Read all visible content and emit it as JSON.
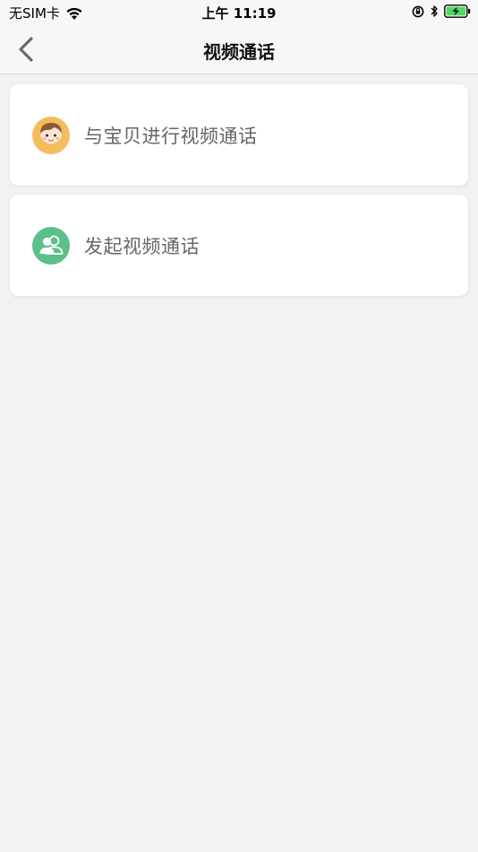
{
  "status_bar": {
    "carrier": "无SIM卡",
    "time": "上午 11:19",
    "icons": [
      "wifi-icon",
      "orientation-lock-icon",
      "bluetooth-icon",
      "battery-charging-icon"
    ]
  },
  "nav": {
    "title": "视频通话",
    "back_icon": "chevron-left-icon"
  },
  "options": [
    {
      "label": "与宝贝进行视频通话",
      "icon": "child-face-icon",
      "icon_color": "#f3bd5b"
    },
    {
      "label": "发起视频通话",
      "icon": "group-people-icon",
      "icon_color": "#5bc08a"
    }
  ],
  "colors": {
    "background": "#f2f2f2",
    "card": "#ffffff",
    "battery_green": "#4cd964"
  }
}
